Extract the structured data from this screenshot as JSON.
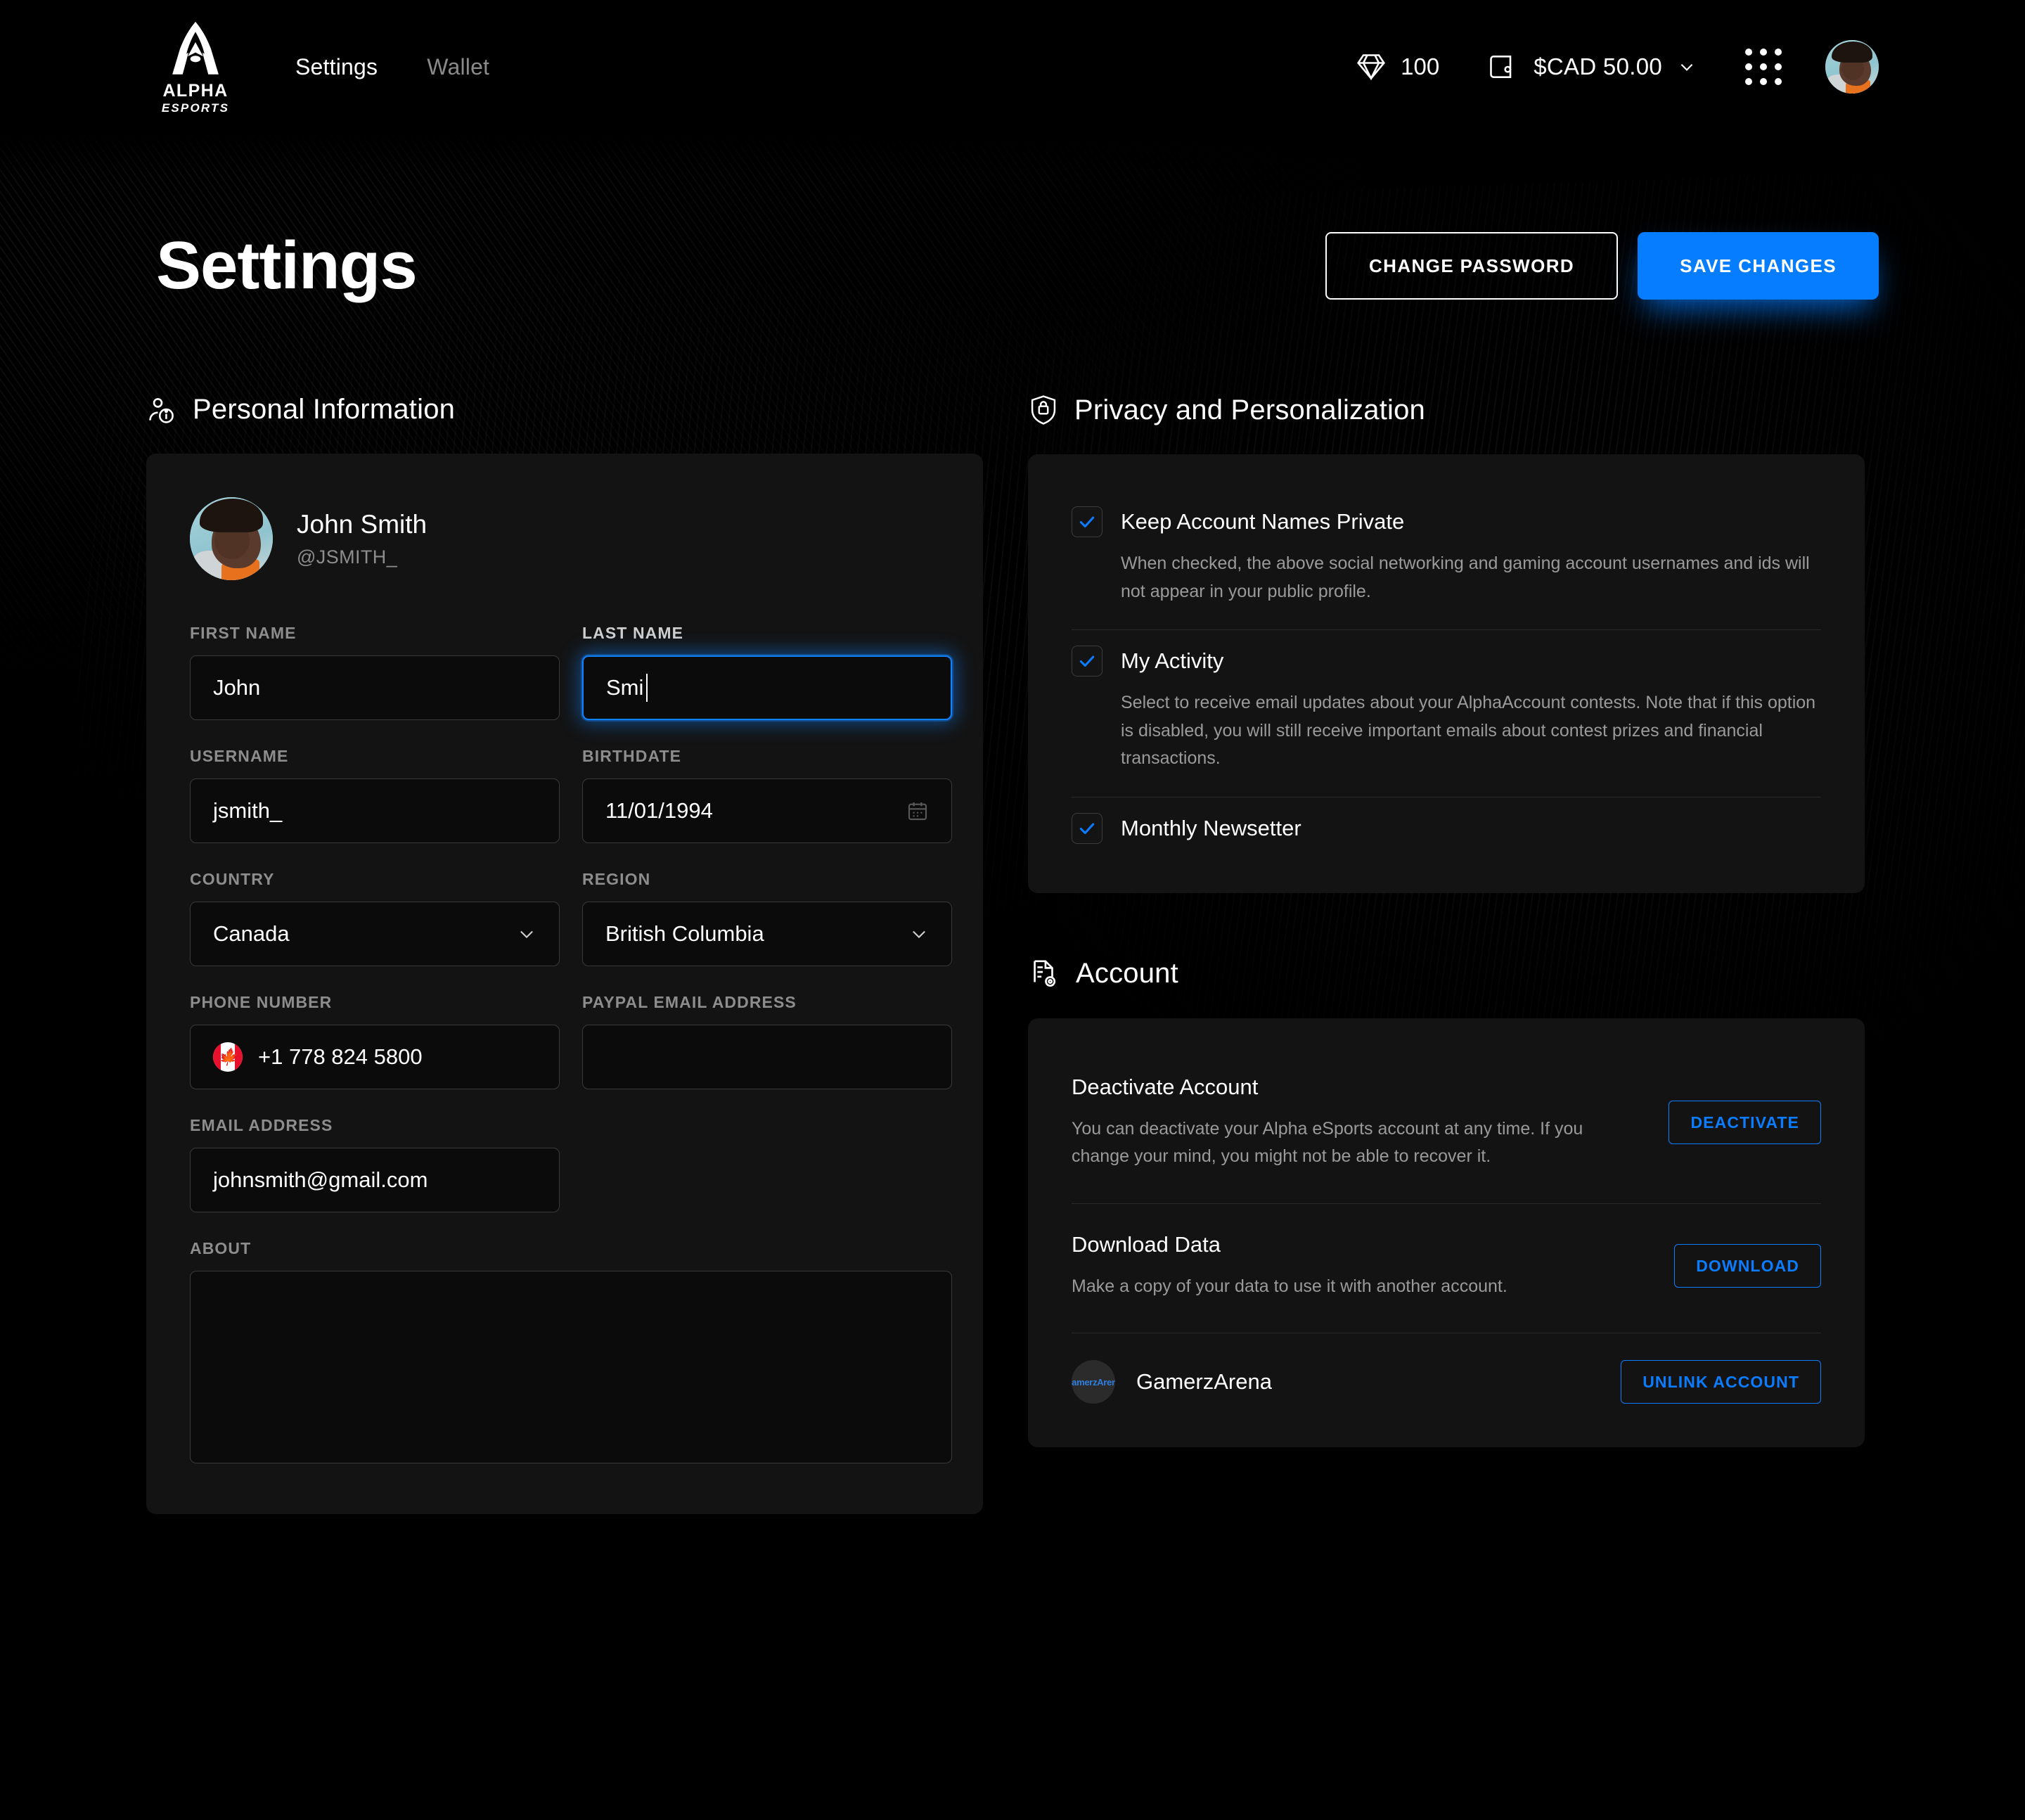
{
  "header": {
    "logo": {
      "name": "ALPHA",
      "sub": "ESPORTS"
    },
    "nav": [
      {
        "label": "Settings",
        "active": true
      },
      {
        "label": "Wallet",
        "active": false
      }
    ],
    "gems": {
      "icon": "diamond-icon",
      "count": "100"
    },
    "wallet": {
      "icon": "wallet-icon",
      "amount": "$CAD 50.00",
      "chevron": "chevron-down-icon"
    },
    "apps_icon": "apps-grid-icon",
    "avatar": "user-avatar"
  },
  "page": {
    "title": "Settings",
    "change_password_label": "CHANGE PASSWORD",
    "save_changes_label": "SAVE CHANGES"
  },
  "personal": {
    "section_title": "Personal Information",
    "section_icon": "user-info-icon",
    "profile": {
      "name": "John Smith",
      "handle": "@JSMITH_"
    },
    "fields": {
      "first_name": {
        "label": "FIRST NAME",
        "value": "John"
      },
      "last_name": {
        "label": "LAST NAME",
        "value": "Smi",
        "focused": true
      },
      "username": {
        "label": "USERNAME",
        "value": "jsmith_"
      },
      "birthdate": {
        "label": "BIRTHDATE",
        "value": "11/01/1994",
        "icon": "calendar-icon"
      },
      "country": {
        "label": "COUNTRY",
        "value": "Canada",
        "icon": "chevron-down-icon"
      },
      "region": {
        "label": "REGION",
        "value": "British Columbia",
        "icon": "chevron-down-icon"
      },
      "phone": {
        "label": "PHONE NUMBER",
        "value": "+1 778 824 5800",
        "flag": "canada-flag-icon"
      },
      "paypal": {
        "label": "PAYPAL EMAIL ADDRESS",
        "value": ""
      },
      "email": {
        "label": "EMAIL ADDRESS",
        "value": "johnsmith@gmail.com"
      },
      "about": {
        "label": "ABOUT",
        "value": ""
      }
    }
  },
  "privacy": {
    "section_title": "Privacy and Personalization",
    "section_icon": "shield-lock-icon",
    "items": [
      {
        "title": "Keep Account Names Private",
        "checked": true,
        "desc": "When checked, the above social networking and gaming account usernames and ids will not appear in your public profile."
      },
      {
        "title": "My Activity",
        "checked": true,
        "desc": "Select to receive email updates about your AlphaAccount contests. Note that if this option is disabled, you will still receive important emails about contest prizes and financial transactions."
      },
      {
        "title": "Monthly Newsetter",
        "checked": true,
        "desc": ""
      }
    ]
  },
  "account": {
    "section_title": "Account",
    "section_icon": "document-gear-icon",
    "rows": [
      {
        "title": "Deactivate Account",
        "desc": "You can deactivate your Alpha eSports account at any time. If you change your mind, you might not be able to recover it.",
        "action": "DEACTIVATE"
      },
      {
        "title": "Download Data",
        "desc": "Make a copy of your data to use it with another account.",
        "action": "DOWNLOAD"
      }
    ],
    "linked": {
      "badge_text": "GamerzArena",
      "name": "GamerzArena",
      "action": "UNLINK ACCOUNT"
    }
  },
  "colors": {
    "accent": "#067cff",
    "background": "#000000",
    "card": "#131313",
    "muted_text": "#8d8d8d"
  }
}
